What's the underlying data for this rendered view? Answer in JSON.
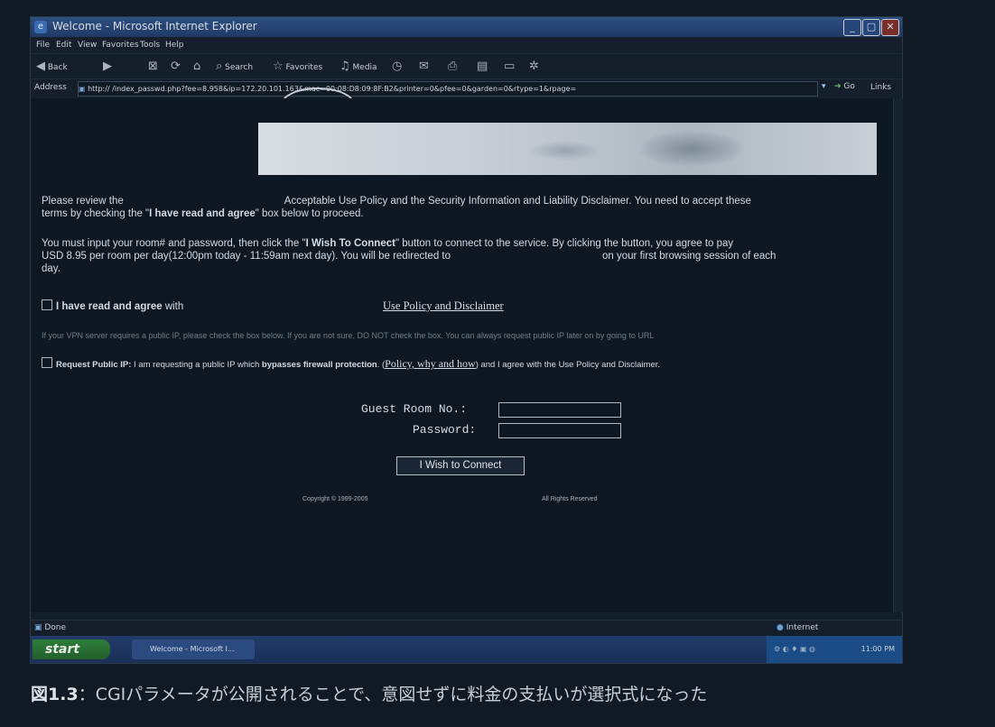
{
  "window": {
    "title": "Welcome - Microsoft Internet Explorer",
    "minimize": "_",
    "maximize": "▢",
    "close": "✕"
  },
  "menu": [
    "File",
    "Edit",
    "View",
    "Favorites",
    "Tools",
    "Help"
  ],
  "toolbar": {
    "back": "Back",
    "search": "Search",
    "favorites": "Favorites",
    "media": "Media"
  },
  "address": {
    "label": "Address",
    "url": "http://                    /index_passwd.php?fee=8.958&ip=172.20.101.163&mac=00:08:D8:09:8F:B2&printer=0&pfee=0&garden=0&rtype=1&rpage=",
    "go": "Go",
    "links": "Links"
  },
  "page": {
    "p1_line1_a": "Please review the",
    "p1_line1_b": "Acceptable Use Policy and the Security Information and Liability Disclaimer. You need to accept these",
    "p1_line2_a": "terms by checking the \"",
    "p1_line2_bold": "I have read and agree",
    "p1_line2_b": "\" box below to proceed.",
    "p2_line1_a": "You must input your room# and password, then click the \"",
    "p2_line1_bold": "I Wish To Connect",
    "p2_line1_b": "\" button to connect to the service. By clicking the button, you agree to pay",
    "p2_line2_a": "USD 8.95 per room per day(12:00pm today - 11:59am next day). You will be redirected to",
    "p2_line2_b": "on your first browsing session of each",
    "p2_line3": "day.",
    "agree_bold": "I have read and agree",
    "agree_rest": " with",
    "policy_link": "Use Policy and Disclaimer",
    "vpn_note": "If your VPN server requires a public IP, please check the box below. If you are not sure, DO NOT check the box. You can always request public IP later on by going to URL",
    "public_ip_bold": "Request Public IP:",
    "public_ip_a": " I am requesting a public IP which ",
    "public_ip_bold2": "bypasses firewall protection",
    "public_ip_b": ". (",
    "public_ip_link": "Policy, why and how",
    "public_ip_c": ") and I agree with the Use Policy and Disclaimer.",
    "room_label": "Guest Room No.:",
    "password_label": "Password:",
    "connect_button": "I Wish to Connect",
    "copyright": "Copyright © 1999-2005",
    "rights": "All Rights Reserved"
  },
  "status": {
    "text": "Done",
    "zone": "Internet"
  },
  "taskbar": {
    "start": "start",
    "item": "Welcome - Microsoft I...",
    "clock": "11:00 PM"
  },
  "caption": {
    "figure": "図1.3",
    "text": "：CGIパラメータが公開されることで、意図せずに料金の支払いが選択式になった"
  },
  "colors": {
    "background": "#0f1a24",
    "titlebar": "#1f3a66",
    "start_button": "#2e7d3a"
  }
}
